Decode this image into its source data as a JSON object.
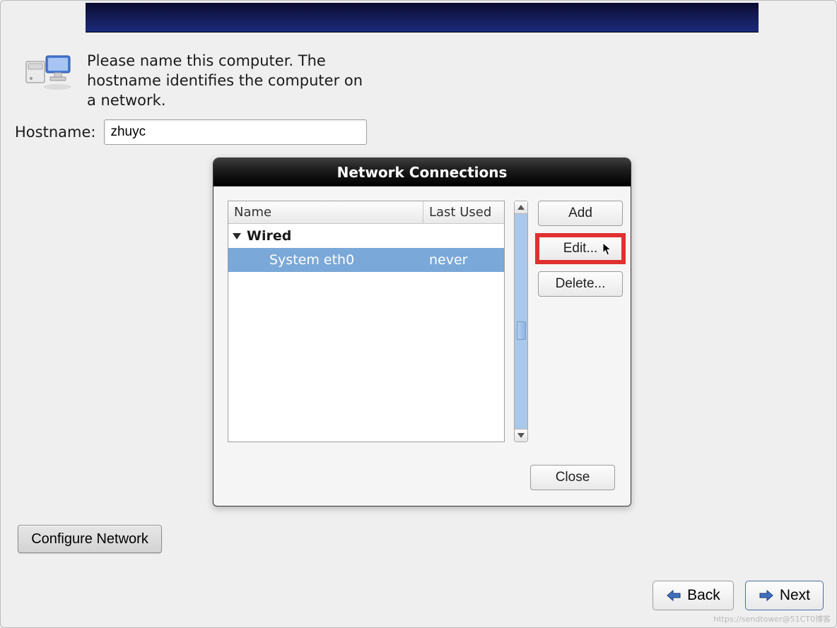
{
  "intro_text": "Please name this computer. The hostname identifies the computer on a network.",
  "hostname": {
    "label": "Hostname:",
    "value": "zhuyc"
  },
  "dialog": {
    "title": "Network Connections",
    "columns": {
      "name": "Name",
      "last_used": "Last Used"
    },
    "group": {
      "label": "Wired"
    },
    "rows": [
      {
        "name": "System eth0",
        "last_used": "never",
        "selected": true
      }
    ],
    "buttons": {
      "add": "Add",
      "edit": "Edit...",
      "delete": "Delete...",
      "close": "Close"
    }
  },
  "buttons": {
    "configure_network": "Configure Network",
    "back": "Back",
    "next": "Next"
  },
  "watermark": "https://sendtower@51CT0博客"
}
